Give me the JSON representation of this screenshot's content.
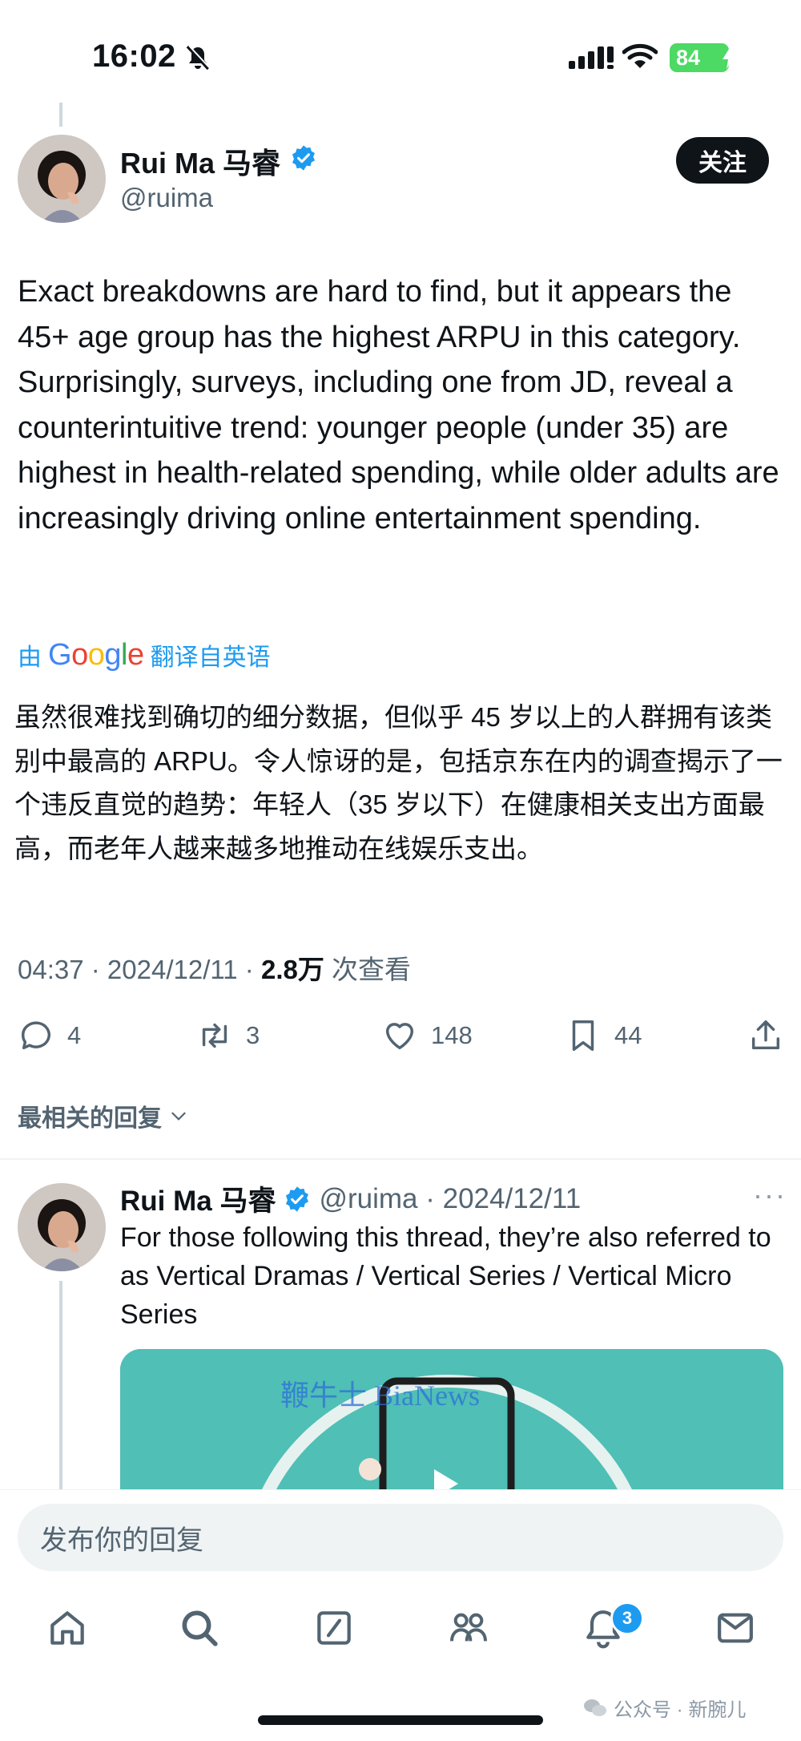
{
  "status_bar": {
    "time": "16:02",
    "battery": "84"
  },
  "tweet": {
    "author_name": "Rui Ma 马睿",
    "handle": "@ruima",
    "follow_label": "关注",
    "text": "Exact breakdowns are hard to find, but it appears the 45+ age group has the highest ARPU in this category. Surprisingly, surveys, including one from JD, reveal a counterintuitive trend: younger people (under 35) are highest in health-related spending, while older adults are increasingly driving online entertainment spending.",
    "translated_prefix": "由",
    "translated_provider": "Google",
    "translated_suffix": "翻译自英语",
    "translated_text": "虽然很难找到确切的细分数据，但似乎 45 岁以上的人群拥有该类别中最高的 ARPU。令人惊讶的是，包括京东在内的调查揭示了一个违反直觉的趋势：年轻人（35 岁以下）在健康相关支出方面最高，而老年人越来越多地推动在线娱乐支出。",
    "time": "04:37",
    "date": "2024/12/11",
    "views_count": "2.8万",
    "views_label": "次查看",
    "replies": "4",
    "retweets": "3",
    "likes": "148",
    "bookmarks": "44"
  },
  "sort": {
    "label": "最相关的回复"
  },
  "reply": {
    "author_name": "Rui Ma 马睿",
    "meta": "@ruima · 2024/12/11",
    "more": "···",
    "text": "For those following this thread, they’re also referred to as Vertical Dramas / Vertical Series / Vertical Micro Series",
    "media_watermark": "鞭牛士 BiaNews"
  },
  "composer": {
    "placeholder": "发布你的回复"
  },
  "tabbar": {
    "notifications_badge": "3"
  },
  "watermark": {
    "text": "公众号 · 新腕儿"
  },
  "colors": {
    "accent": "#1d9bf0",
    "text": "#0f1419",
    "secondary": "#536471",
    "media_bg": "#50bfb6"
  }
}
